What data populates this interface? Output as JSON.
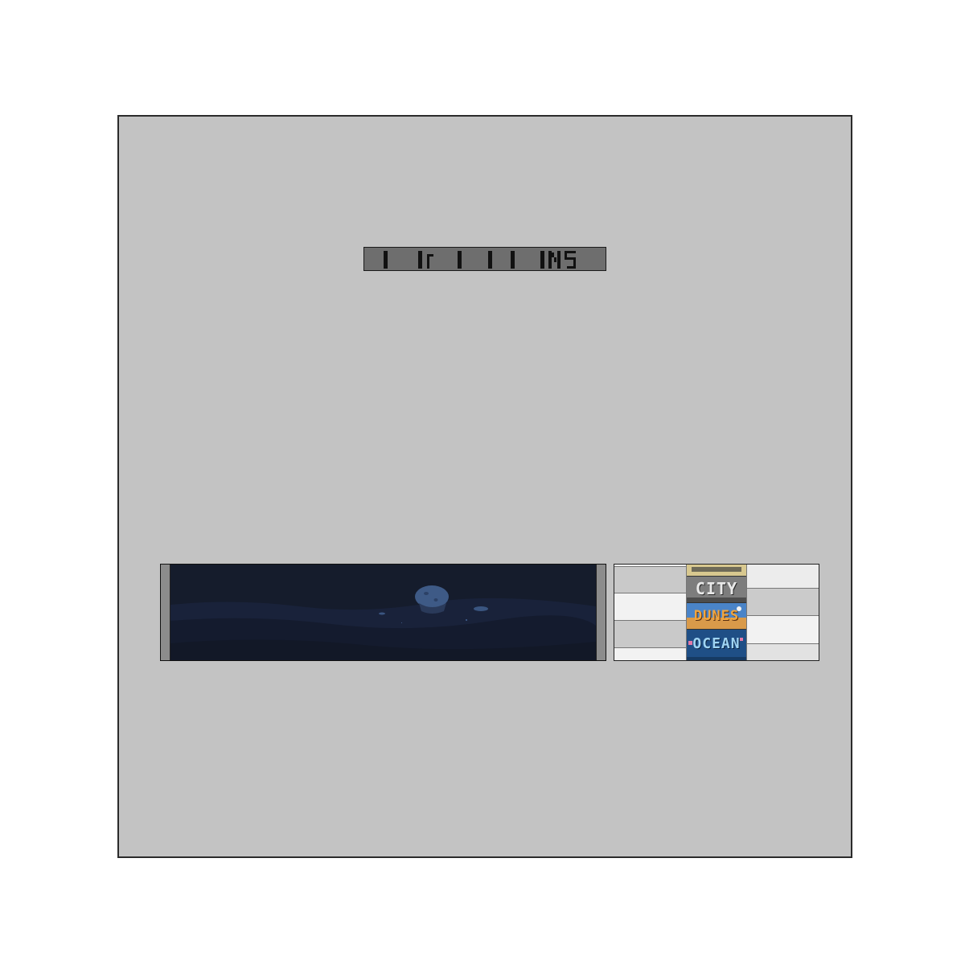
{
  "screen": {
    "title": "",
    "background_color": "#c3c3c3",
    "title_bar_color": "#6e6e6e"
  },
  "preview": {
    "scene": "ocean",
    "sky_color": "#151c2c",
    "moon_color": "#3e5a86"
  },
  "levels": [
    {
      "name": "",
      "theme_color": "#d8c88f"
    },
    {
      "name": "CITY",
      "theme_color": "#7d7d7d"
    },
    {
      "name": "DUNES",
      "theme_color": "#4a84c8"
    },
    {
      "name": "OCEAN",
      "theme_color": "#1f4f86"
    }
  ]
}
